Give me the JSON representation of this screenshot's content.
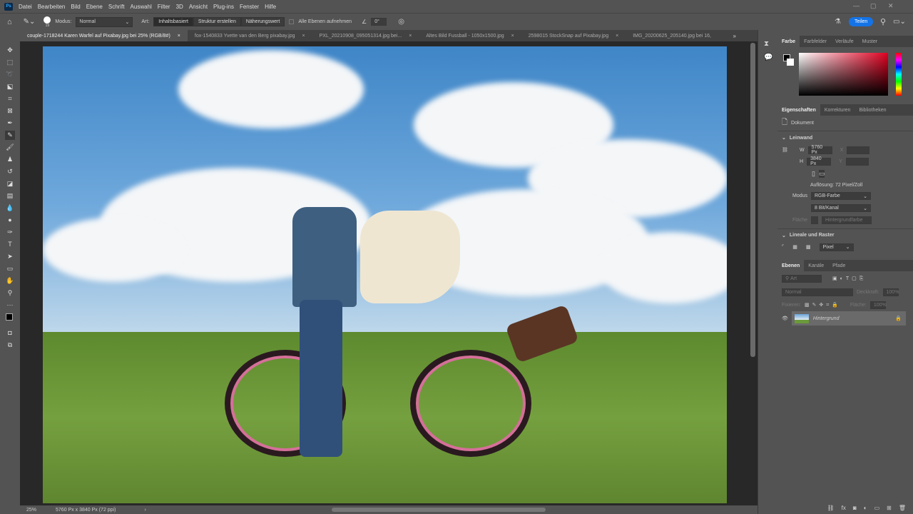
{
  "app": {
    "logo": "Ps",
    "menu": [
      "Datei",
      "Bearbeiten",
      "Bild",
      "Ebene",
      "Schrift",
      "Auswahl",
      "Filter",
      "3D",
      "Ansicht",
      "Plug-ins",
      "Fenster",
      "Hilfe"
    ]
  },
  "options": {
    "brush_size": "19",
    "mode_label": "Modus:",
    "mode_value": "Normal",
    "type_label": "Art:",
    "type_buttons": [
      "Inhaltsbasiert",
      "Struktur erstellen",
      "Näherungswert"
    ],
    "sample_all_label": "Alle Ebenen aufnehmen",
    "angle_value": "0°",
    "share_label": "Teilen"
  },
  "tabs": [
    "couple-1718244 Karen Warfel auf Pixabay.jpg bei 25% (RGB/8#)",
    "fox-1540833 Yvette van den Berg pixabay.jpg",
    "PXL_20210908_095051314.jpg bei...",
    "Altes Bild Fussball - 1050x1500.jpg",
    "2598015 StockSnap auf Pixabay.jpg",
    "IMG_20200625_205140.jpg bei 16,"
  ],
  "status": {
    "zoom": "25%",
    "doc_info": "5760 Px x 3840 Px (72 ppi)"
  },
  "color_panel": {
    "tabs": [
      "Farbe",
      "Farbfelder",
      "Verläufe",
      "Muster"
    ]
  },
  "properties": {
    "tabs": [
      "Eigenschaften",
      "Korrekturen",
      "Bibliotheken"
    ],
    "doc_label": "Dokument",
    "canvas_section": "Leinwand",
    "w_label": "W",
    "w_value": "5760 Px",
    "h_label": "H",
    "h_value": "3840 Px",
    "x_label": "X",
    "y_label": "Y",
    "resolution": "Auflösung: 72 Pixel/Zoll",
    "mode_label": "Modus",
    "mode_value": "RGB-Farbe",
    "depth_value": "8 Bit/Kanal",
    "fill_label": "Fläche",
    "fill_value": "Hintergrundfarbe",
    "rulers_section": "Lineale und Raster",
    "unit_value": "Pixel"
  },
  "layers": {
    "tabs": [
      "Ebenen",
      "Kanäle",
      "Pfade"
    ],
    "filter_placeholder": "Art",
    "blend_mode": "Normal",
    "opacity_label": "Deckkraft:",
    "opacity_value": "100%",
    "lock_label": "Fixieren:",
    "fill_label": "Fläche:",
    "fill_value": "100%",
    "items": [
      {
        "name": "Hintergrund",
        "visible": true,
        "locked": true
      }
    ]
  },
  "colors": {
    "accent": "#1473e6",
    "bg": "#535353",
    "canvas": "#282828"
  }
}
